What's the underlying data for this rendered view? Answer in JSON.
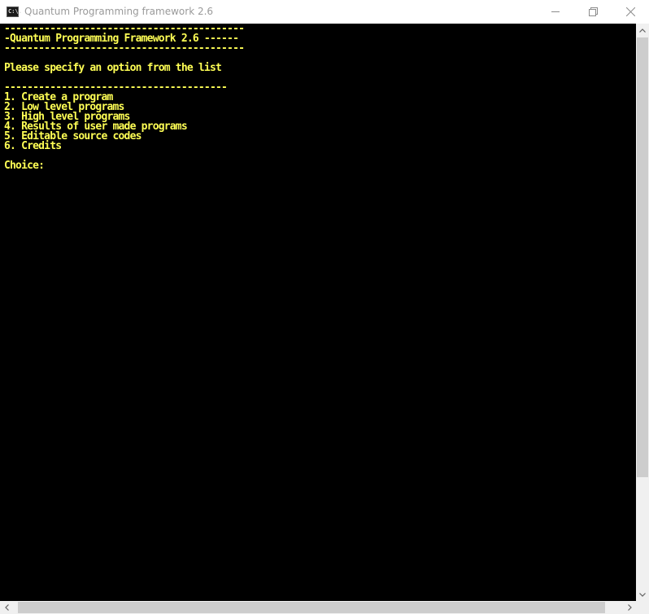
{
  "window": {
    "title": "Quantum Programming framework 2.6",
    "icon": "console-icon",
    "icon_label": "C:\\."
  },
  "console": {
    "lines": [
      "------------------------------------------",
      "-Quantum Programming Framework 2.6 ------",
      "------------------------------------------",
      "",
      "Please specify an option from the list",
      "",
      "---------------------------------------",
      "1. Create a program",
      "2. Low level programs",
      "3. High level programs",
      "4. Results of user made programs",
      "5. Editable source codes",
      "6. Credits",
      "",
      "Choice:"
    ]
  },
  "colors": {
    "console_background": "#000000",
    "console_text": "#ffff55",
    "title_text": "#9a9a9a"
  }
}
